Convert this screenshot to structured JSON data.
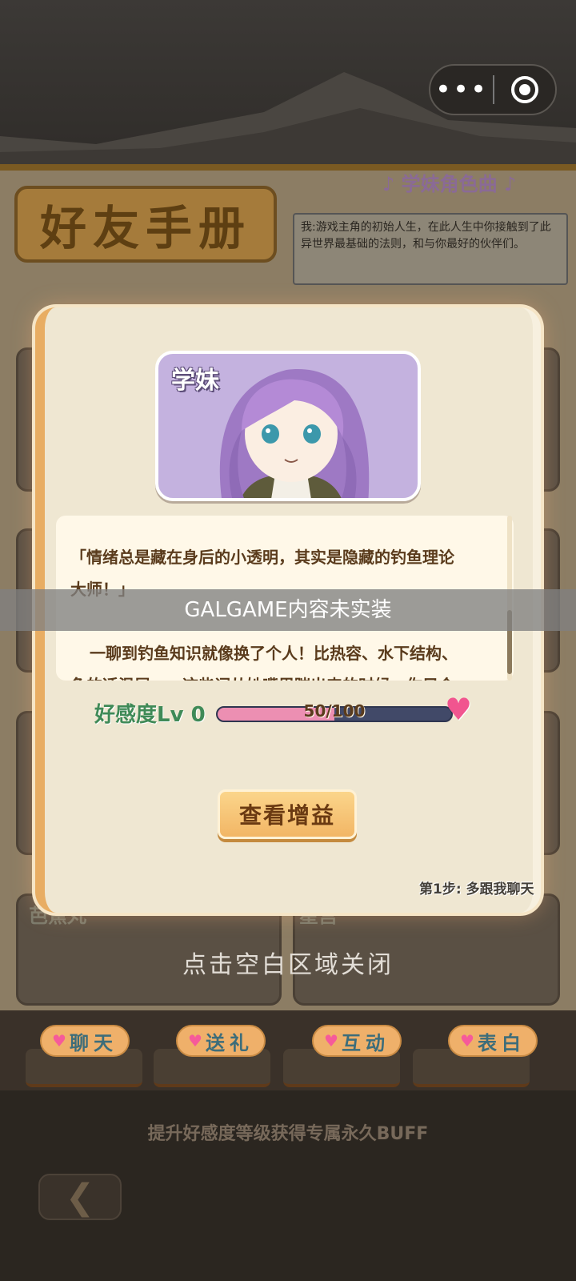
{
  "background": {
    "book_title": "好友手册",
    "song_title": "♪ 学妹角色曲 ♪",
    "intro_text": "我:游戏主角的初始人生，在此人生中你接触到了此异世界最基础的法则，和与你最好的伙伴们。",
    "friend_names": [
      "芭蕉丸",
      "星宫"
    ],
    "close_hint": "点击空白区域关闭",
    "buff_note": "提升好感度等级获得专属永久BUFF",
    "back_icon": "chevron-left-icon"
  },
  "capsule": {
    "more_label": "•••",
    "close_icon": "target-icon"
  },
  "modal": {
    "character_name": "学妹",
    "description_lines": [
      "「情绪总是藏在身后的小透明，其实是隐藏的钓鱼理论",
      "大师！」",
      "",
      "一聊到钓鱼知识就像换了个人！比热容、水下结构、",
      "鱼的适温层……这些词从她嘴里蹦出来的时候，你只会"
    ],
    "affinity_label": "好感度Lv 0",
    "affinity_text": "50/100",
    "affinity_fraction": 0.5,
    "view_button": "查看增益",
    "step_hint": "第1步: 多跟我聊天"
  },
  "banner": "GALGAME内容未实装",
  "actions": [
    {
      "heart": "♥",
      "label": "聊天"
    },
    {
      "heart": "♥",
      "label": "送礼"
    },
    {
      "heart": "♥",
      "label": "互动"
    },
    {
      "heart": "♥",
      "label": "表白"
    }
  ],
  "colors": {
    "modal_bg": "#efe7d2",
    "accent_orange": "#e8ad63",
    "affinity_pink": "#ec8fb2",
    "affinity_track": "#414968",
    "affinity_green": "#3f8a57"
  }
}
